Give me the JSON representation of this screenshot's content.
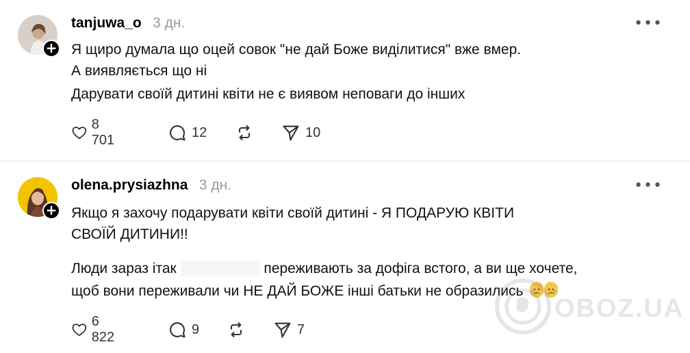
{
  "posts": [
    {
      "username": "tanjuwa_o",
      "time": "3 дн.",
      "lines": [
        "Я щиро думала що оцей совок \"не дай Боже виділитися\" вже вмер.",
        "А виявляється що ні",
        "Дарувати своїй дитині квіти не є виявом неповаги до інших"
      ],
      "likes": "8 701",
      "replies": "12",
      "shares": "10"
    },
    {
      "username": "olena.prysiazhna",
      "time": "3 дн.",
      "para1": [
        "Якщо я захочу подарувати квіти своїй дитині - Я ПОДАРУЮ КВІТИ",
        "СВОЇЙ ДИТИНИ!!"
      ],
      "para2_line1_a": "Люди зараз ітак",
      "para2_line1_b": "переживають за дофіга встого, а ви ще хочете,",
      "para2_line2": "щоб вони переживали чи НЕ ДАЙ БОЖЕ інші батьки не образились",
      "likes": "6 822",
      "replies": "9",
      "shares": "7"
    }
  ],
  "watermark": {
    "text": "OBOZ.UA"
  },
  "icons": {
    "like": "heart-icon",
    "reply": "comment-icon",
    "repost": "repost-icon",
    "share": "send-icon",
    "more": "more-dots-icon",
    "follow": "plus-icon"
  },
  "colors": {
    "text": "#111111",
    "muted": "#9a9a9a",
    "divider": "#e3e3e3",
    "avatar2": "#f1c400"
  }
}
